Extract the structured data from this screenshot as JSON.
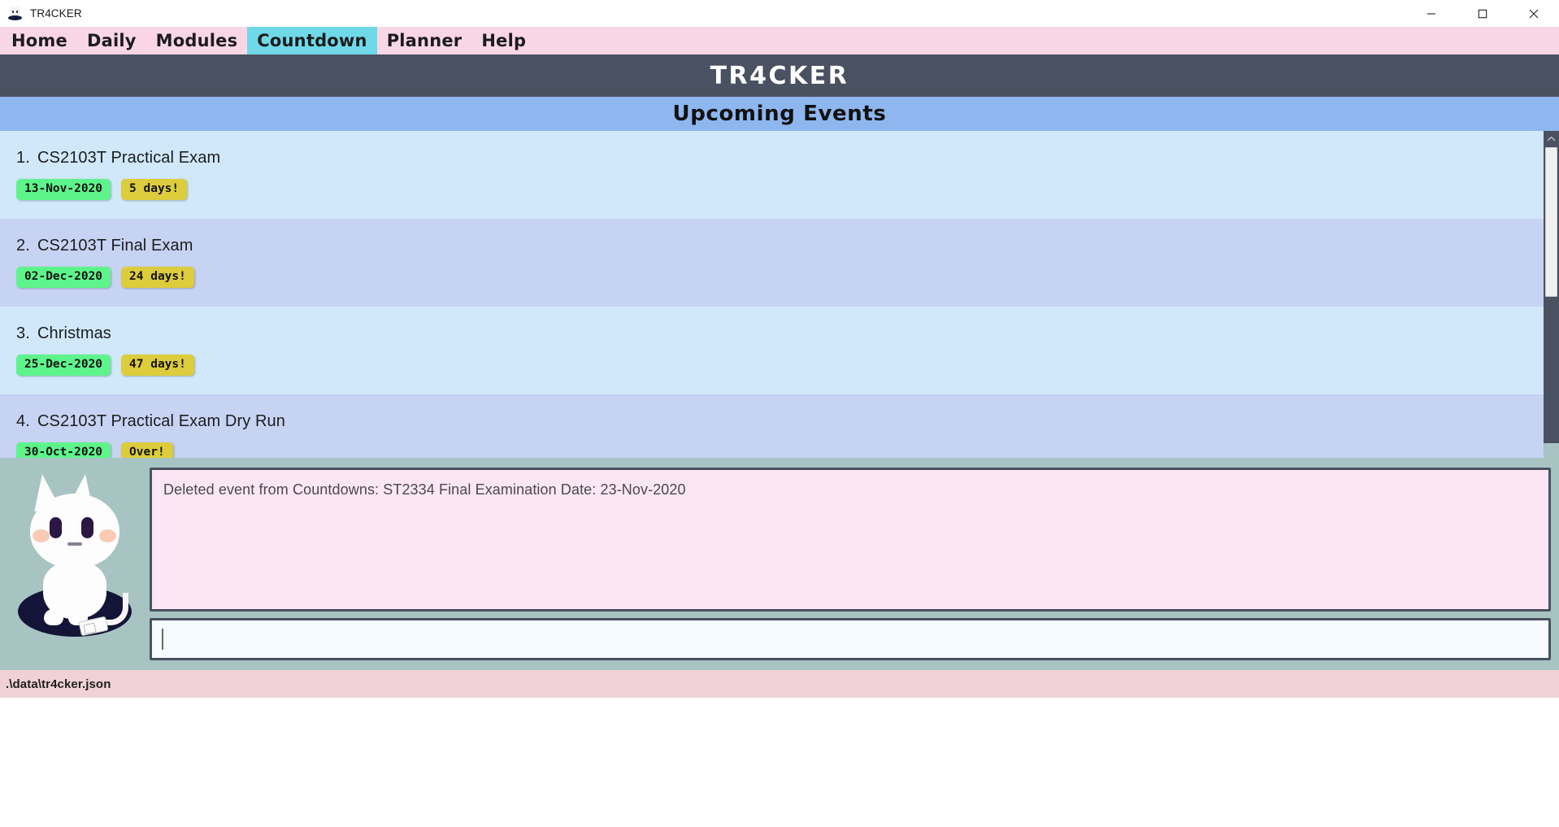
{
  "window": {
    "title": "TR4CKER",
    "icon": "cat-mascot-icon",
    "controls": {
      "minimize": "minimize-icon",
      "maximize": "maximize-icon",
      "close": "close-icon"
    }
  },
  "menubar": {
    "items": [
      {
        "label": "Home",
        "active": false
      },
      {
        "label": "Daily",
        "active": false
      },
      {
        "label": "Modules",
        "active": false
      },
      {
        "label": "Countdown",
        "active": true
      },
      {
        "label": "Planner",
        "active": false
      },
      {
        "label": "Help",
        "active": false
      }
    ],
    "accent_active": "#6fd9e8",
    "background": "#f9d6e6"
  },
  "banner": {
    "title": "TR4CKER",
    "background": "#4a5160"
  },
  "section": {
    "title": "Upcoming Events",
    "background": "#8eb6ef"
  },
  "events": [
    {
      "index": "1.",
      "title": "CS2103T Practical Exam",
      "date": "13-Nov-2020",
      "countdown": "5 days!",
      "row_style": "plain"
    },
    {
      "index": "2.",
      "title": "CS2103T Final Exam",
      "date": "02-Dec-2020",
      "countdown": "24 days!",
      "row_style": "alt"
    },
    {
      "index": "3.",
      "title": "Christmas",
      "date": "25-Dec-2020",
      "countdown": "47 days!",
      "row_style": "plain"
    },
    {
      "index": "4.",
      "title": "CS2103T Practical Exam Dry Run",
      "date": "30-Oct-2020",
      "countdown": "Over!",
      "row_style": "alt"
    }
  ],
  "badge_colors": {
    "date": "#5df58b",
    "countdown": "#ddcc3b"
  },
  "scrollbar": {
    "up_arrow": "chevron-up-icon",
    "down_arrow": "chevron-down-icon"
  },
  "result_display": {
    "text": "Deleted event from Countdowns: ST2334 Final Examination Date: 23-Nov-2020",
    "background": "#fae6f5"
  },
  "command_box": {
    "value": "",
    "placeholder": ""
  },
  "statusbar": {
    "path": ".\\data\\tr4cker.json",
    "background": "#f0d2d5"
  }
}
